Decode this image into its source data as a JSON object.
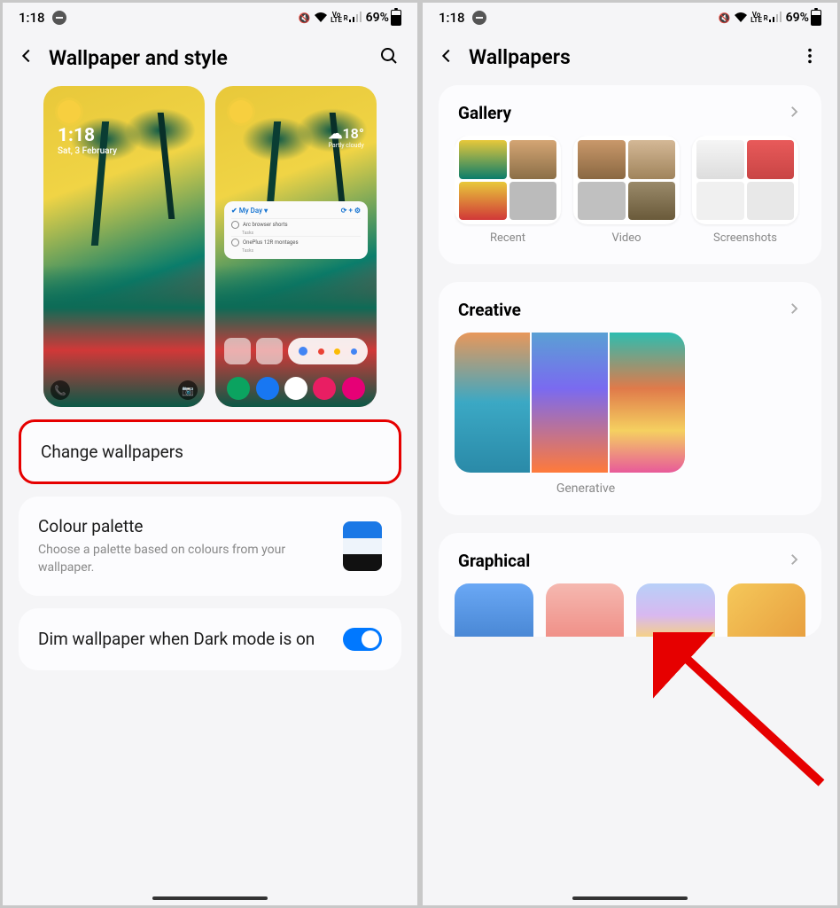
{
  "status": {
    "time": "1:18",
    "lte": "Vo LTE",
    "r": "R",
    "battery": "69%"
  },
  "screen1": {
    "title": "Wallpaper and style",
    "lock_preview": {
      "time": "1:18",
      "date": "Sat, 3 February"
    },
    "home_preview": {
      "temp": "18°",
      "widget_title": "My Day",
      "task1": "Arc browser shorts",
      "task1_sub": "Tasks",
      "task2": "OnePlus 12R montages",
      "task2_sub": "Tasks"
    },
    "change_wallpapers": "Change wallpapers",
    "colour_palette": {
      "title": "Colour palette",
      "sub": "Choose a palette based on colours from your wallpaper."
    },
    "dim": "Dim wallpaper when Dark mode is on"
  },
  "screen2": {
    "title": "Wallpapers",
    "gallery": {
      "title": "Gallery",
      "items": [
        "Recent",
        "Video",
        "Screenshots"
      ]
    },
    "creative": {
      "title": "Creative",
      "item": "Generative"
    },
    "graphical": {
      "title": "Graphical"
    }
  }
}
